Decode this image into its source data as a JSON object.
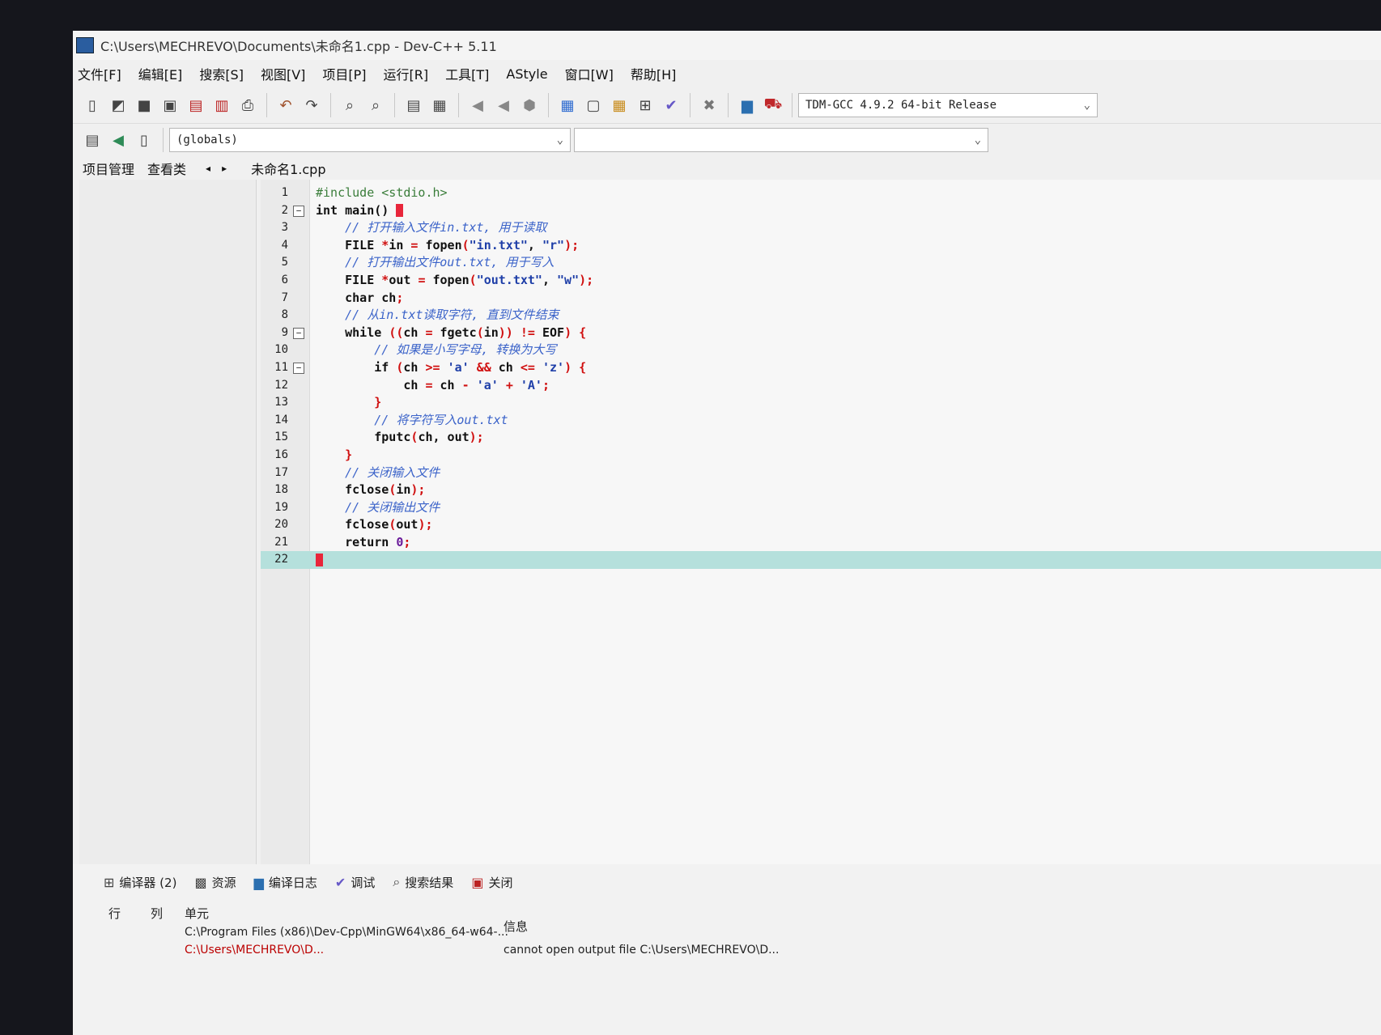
{
  "window": {
    "title": "C:\\Users\\MECHREVO\\Documents\\未命名1.cpp - Dev-C++ 5.11"
  },
  "menu": [
    "文件[F]",
    "编辑[E]",
    "搜索[S]",
    "视图[V]",
    "项目[P]",
    "运行[R]",
    "工具[T]",
    "AStyle",
    "窗口[W]",
    "帮助[H]"
  ],
  "toolbar": {
    "compiler_select": "TDM-GCC 4.9.2 64-bit Release",
    "scope_select": "(globals)",
    "member_select": ""
  },
  "left_tabs": {
    "project": "项目管理",
    "classes": "查看类",
    "prev": "◂",
    "next": "▸"
  },
  "editor": {
    "file_tab": "未命名1.cpp",
    "lines": [
      "1",
      "2",
      "3",
      "4",
      "5",
      "6",
      "7",
      "8",
      "9",
      "10",
      "11",
      "12",
      "13",
      "14",
      "15",
      "16",
      "17",
      "18",
      "19",
      "20",
      "21",
      "22"
    ]
  },
  "bottom": {
    "tabs": [
      "编译器 (2)",
      "资源",
      "编译日志",
      "调试",
      "搜索结果",
      "关闭"
    ],
    "headers": {
      "row": "行",
      "col": "列",
      "unit": "单元",
      "info": "信息"
    },
    "messages": [
      {
        "unit": "C:\\Program Files (x86)\\Dev-Cpp\\MinGW64\\x86_64-w64-...",
        "info": ""
      },
      {
        "unit": "C:\\Users\\MECHREVO\\D...",
        "info": "cannot open output file C:\\Users\\MECHREVO\\D..."
      }
    ]
  },
  "colors": {
    "comment": "#3b63c9",
    "string": "#1f3fa8",
    "operator": "#d01010",
    "active_line": "#b5e0dc",
    "caret": "#e8263b"
  }
}
